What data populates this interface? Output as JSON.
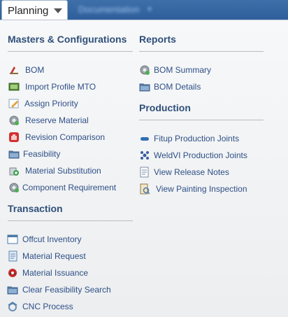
{
  "tabs": {
    "active_label": "Planning",
    "inactive_label": "Documentation"
  },
  "masters": {
    "title": "Masters & Configurations",
    "items": [
      {
        "label": "BOM",
        "icon": "bom-icon"
      },
      {
        "label": "Import Profile MTO",
        "icon": "import-icon"
      },
      {
        "label": "Assign Priority",
        "icon": "pencil-icon"
      },
      {
        "label": "Reserve Material",
        "icon": "gear-icon"
      },
      {
        "label": "Revision Comparison",
        "icon": "hand-icon"
      },
      {
        "label": "Feasibility",
        "icon": "folder-icon"
      },
      {
        "label": "Material Substitution",
        "icon": "substitution-icon"
      },
      {
        "label": "Component Requirement",
        "icon": "gear-icon"
      }
    ]
  },
  "transaction": {
    "title": "Transaction",
    "items": [
      {
        "label": "Offcut Inventory",
        "icon": "window-icon"
      },
      {
        "label": "Material Request",
        "icon": "document-icon"
      },
      {
        "label": "Material Issuance",
        "icon": "issuance-icon"
      },
      {
        "label": "Clear Feasibility Search",
        "icon": "folder-icon"
      },
      {
        "label": "CNC Process",
        "icon": "process-icon"
      }
    ]
  },
  "reports": {
    "title": "Reports",
    "items": [
      {
        "label": "BOM Summary",
        "icon": "gear-icon"
      },
      {
        "label": "BOM Details",
        "icon": "folder-icon"
      }
    ]
  },
  "production": {
    "title": "Production",
    "items": [
      {
        "label": "Fitup Production Joints",
        "icon": "pipe-icon"
      },
      {
        "label": "WeldVI Production Joints",
        "icon": "weld-icon"
      },
      {
        "label": "View Release Notes",
        "icon": "notes-icon"
      },
      {
        "label": "View Painting Inspection",
        "icon": "inspection-icon"
      }
    ]
  }
}
